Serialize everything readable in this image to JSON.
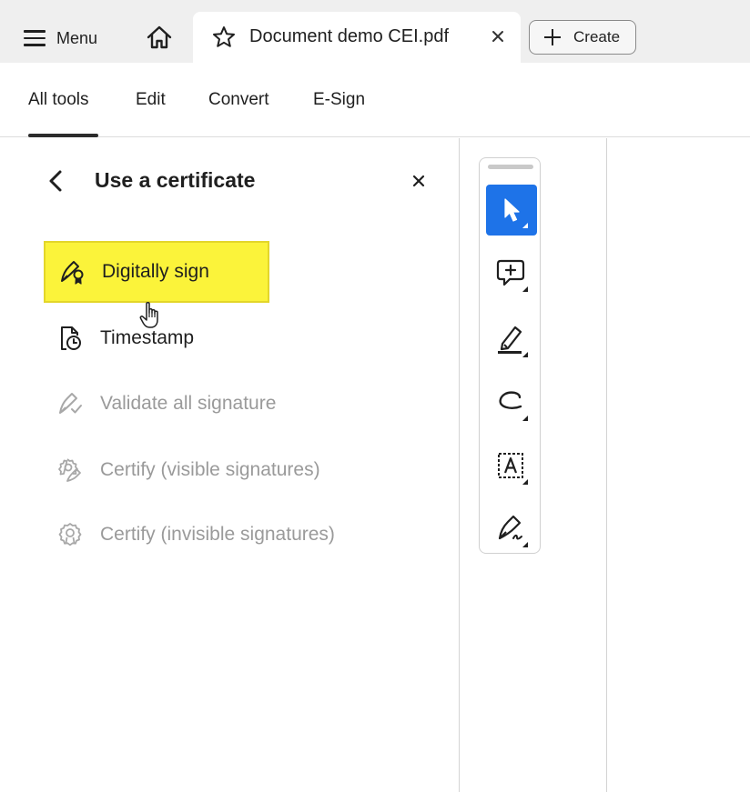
{
  "titlebar": {
    "menu_label": "Menu",
    "tab_title": "Document demo CEI.pdf",
    "create_label": "Create"
  },
  "nav": {
    "items": [
      {
        "label": "All tools",
        "active": true
      },
      {
        "label": "Edit",
        "active": false
      },
      {
        "label": "Convert",
        "active": false
      },
      {
        "label": "E-Sign",
        "active": false
      }
    ]
  },
  "panel": {
    "title": "Use a certificate",
    "items": [
      {
        "label": "Digitally sign",
        "icon": "digital-sign-icon",
        "enabled": true,
        "highlighted": true
      },
      {
        "label": "Timestamp",
        "icon": "timestamp-icon",
        "enabled": true,
        "highlighted": false
      },
      {
        "label": "Validate all signature",
        "icon": "validate-signature-icon",
        "enabled": false,
        "highlighted": false
      },
      {
        "label": "Certify (visible signatures)",
        "icon": "certify-visible-icon",
        "enabled": false,
        "highlighted": false
      },
      {
        "label": "Certify (invisible signatures)",
        "icon": "certify-invisible-icon",
        "enabled": false,
        "highlighted": false
      }
    ]
  },
  "toolbar": {
    "tools": [
      {
        "name": "select-tool",
        "icon": "pointer-icon",
        "active": true
      },
      {
        "name": "comment-tool",
        "icon": "add-comment-icon",
        "active": false
      },
      {
        "name": "highlight-tool",
        "icon": "highlighter-icon",
        "active": false
      },
      {
        "name": "draw-tool",
        "icon": "freehand-draw-icon",
        "active": false
      },
      {
        "name": "text-tool",
        "icon": "text-box-icon",
        "active": false
      },
      {
        "name": "sign-tool",
        "icon": "fill-sign-icon",
        "active": false
      }
    ]
  },
  "colors": {
    "highlight": "#fbf33a",
    "active_tool": "#1e73e8",
    "disabled_text": "#9a9a9a",
    "titlebar_bg": "#efefef"
  }
}
